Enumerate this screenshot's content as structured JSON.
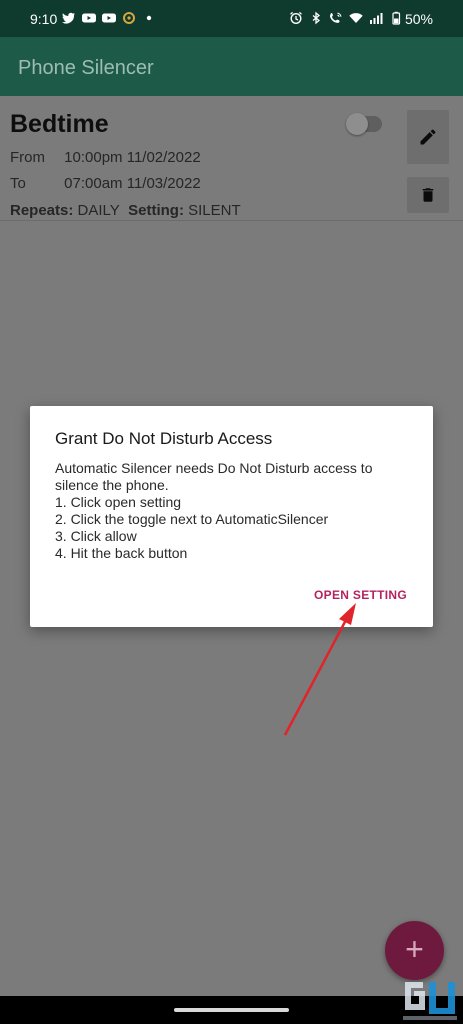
{
  "status_bar": {
    "time": "9:10",
    "battery": "50%",
    "left_icons": [
      "twitter-icon",
      "youtube-icon",
      "youtube-icon",
      "app-icon",
      "dot-icon"
    ],
    "right_icons": [
      "alarm-icon",
      "bluetooth-icon",
      "wifi-calling-icon",
      "wifi-icon",
      "signal-icon",
      "battery-icon"
    ]
  },
  "app_bar": {
    "title": "Phone Silencer"
  },
  "schedule": {
    "name": "Bedtime",
    "from_label": "From",
    "from_value": "10:00pm 11/02/2022",
    "to_label": "To",
    "to_value": "07:00am 11/03/2022",
    "repeats_label": "Repeats:",
    "repeats_value": "DAILY",
    "setting_label": "Setting:",
    "setting_value": "SILENT",
    "enabled": false
  },
  "dialog": {
    "title": "Grant Do Not Disturb Access",
    "lines": [
      "Automatic Silencer needs Do Not Disturb access to",
      "silence the phone.",
      "1. Click open setting",
      "2. Click the toggle next to AutomaticSilencer",
      "3. Click allow",
      "4. Hit the back button"
    ],
    "button_label": "OPEN SETTING"
  },
  "fab": {
    "label": "+"
  },
  "colors": {
    "status_bar": "#0f3a2e",
    "app_bar": "#1d5a48",
    "accent": "#b5235f",
    "fab": "#6e1a3e",
    "arrow": "#e0242a"
  }
}
